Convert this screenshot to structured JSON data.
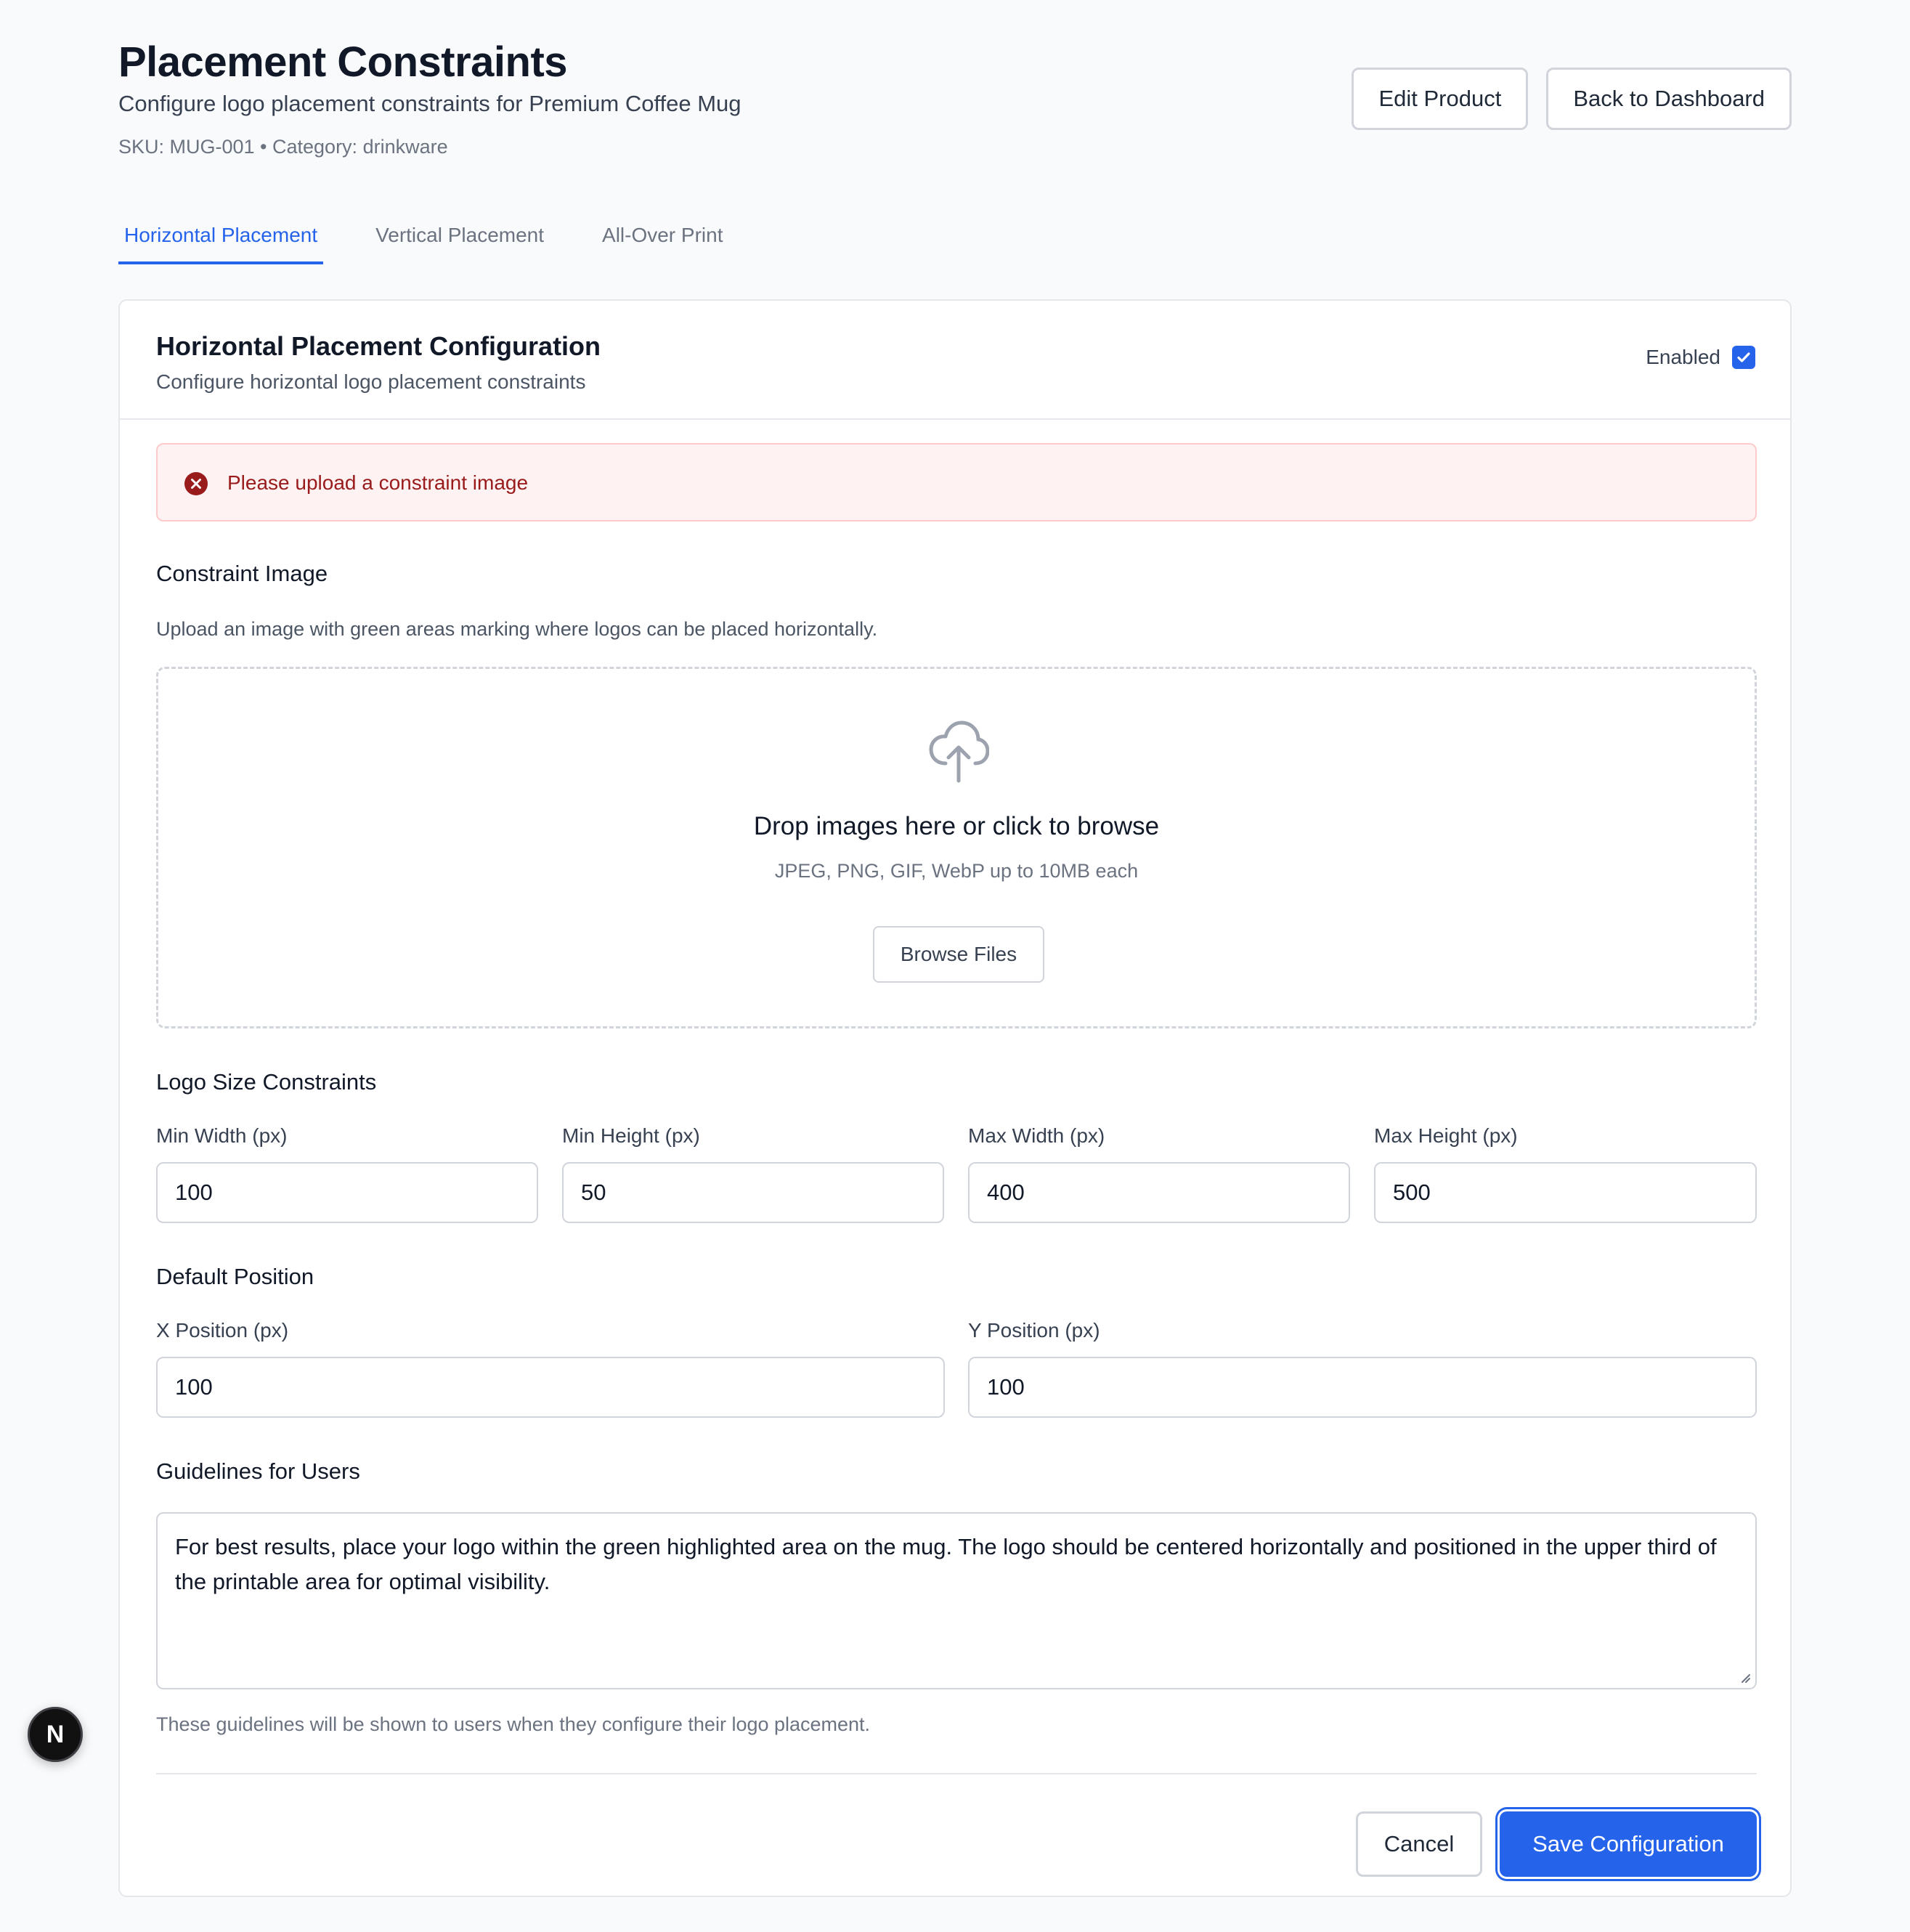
{
  "header": {
    "title": "Placement Constraints",
    "subtitle": "Configure logo placement constraints for Premium Coffee Mug",
    "meta": "SKU: MUG-001 • Category: drinkware",
    "edit_label": "Edit Product",
    "back_label": "Back to Dashboard"
  },
  "tabs": [
    {
      "label": "Horizontal Placement",
      "active": true
    },
    {
      "label": "Vertical Placement",
      "active": false
    },
    {
      "label": "All-Over Print",
      "active": false
    }
  ],
  "card": {
    "title": "Horizontal Placement Configuration",
    "description": "Configure horizontal logo placement constraints",
    "enabled_label": "Enabled",
    "enabled": true
  },
  "alert": {
    "message": "Please upload a constraint image",
    "icon": "error-circle-icon"
  },
  "constraint_image": {
    "title": "Constraint Image",
    "help": "Upload an image with green areas marking where logos can be placed horizontally.",
    "drop_title": "Drop images here or click to browse",
    "drop_sub": "JPEG, PNG, GIF, WebP up to 10MB each",
    "browse_label": "Browse Files",
    "icon": "cloud-upload-icon"
  },
  "size_constraints": {
    "title": "Logo Size Constraints",
    "min_width_label": "Min Width (px)",
    "min_width": "100",
    "min_height_label": "Min Height (px)",
    "min_height": "50",
    "max_width_label": "Max Width (px)",
    "max_width": "400",
    "max_height_label": "Max Height (px)",
    "max_height": "500"
  },
  "default_position": {
    "title": "Default Position",
    "x_label": "X Position (px)",
    "x": "100",
    "y_label": "Y Position (px)",
    "y": "100"
  },
  "guidelines": {
    "title": "Guidelines for Users",
    "text": "For best results, place your logo within the green highlighted area on the mug. The logo should be centered horizontally and positioned in the upper third of the printable area for optimal visibility.",
    "help": "These guidelines will be shown to users when they configure their logo placement."
  },
  "actions": {
    "cancel_label": "Cancel",
    "save_label": "Save Configuration"
  },
  "badge": {
    "letter": "N"
  },
  "colors": {
    "accent": "#2563eb",
    "error_bg": "#fef2f2",
    "error_text": "#991b1b"
  }
}
